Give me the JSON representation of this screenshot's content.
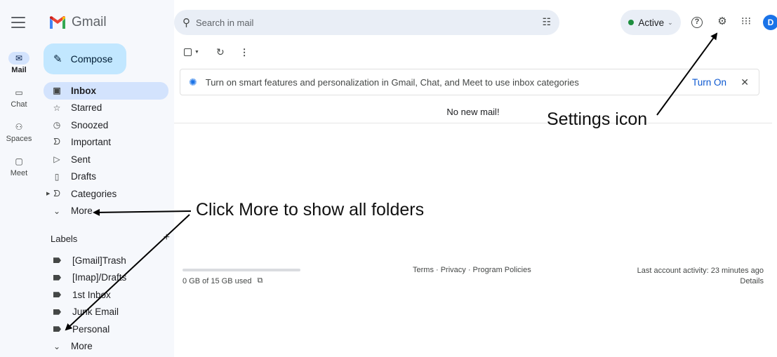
{
  "app": {
    "name": "Gmail"
  },
  "rail": {
    "items": [
      {
        "label": "Mail",
        "icon": "mail-icon",
        "active": true
      },
      {
        "label": "Chat",
        "icon": "chat-icon"
      },
      {
        "label": "Spaces",
        "icon": "spaces-icon"
      },
      {
        "label": "Meet",
        "icon": "meet-icon"
      }
    ]
  },
  "compose": {
    "label": "Compose"
  },
  "nav": {
    "items": [
      {
        "label": "Inbox",
        "icon": "inbox-icon",
        "active": true
      },
      {
        "label": "Starred",
        "icon": "star-icon"
      },
      {
        "label": "Snoozed",
        "icon": "clock-icon"
      },
      {
        "label": "Important",
        "icon": "important-icon"
      },
      {
        "label": "Sent",
        "icon": "send-icon"
      },
      {
        "label": "Drafts",
        "icon": "draft-icon"
      },
      {
        "label": "Categories",
        "icon": "category-icon"
      },
      {
        "label": "More",
        "icon": "chevron-down-icon"
      }
    ]
  },
  "labels": {
    "title": "Labels",
    "add": "+",
    "items": [
      {
        "label": "[Gmail]Trash"
      },
      {
        "label": "[Imap]/Drafts"
      },
      {
        "label": "1st Inbox"
      },
      {
        "label": "Junk Email"
      },
      {
        "label": "Personal"
      }
    ],
    "more": "More"
  },
  "search": {
    "placeholder": "Search in mail"
  },
  "status": {
    "label": "Active",
    "color": "#1e8e3e"
  },
  "avatar": {
    "initial": "D",
    "color": "#1a73e8"
  },
  "banner": {
    "text": "Turn on smart features and personalization in Gmail, Chat, and Meet to use inbox categories",
    "action": "Turn On",
    "close": "✕"
  },
  "main": {
    "empty": "No new mail!",
    "storage": "0 GB of 15 GB used",
    "footer_links": "Terms · Privacy · Program Policies",
    "last_activity": "Last account activity: 23 minutes ago",
    "details": "Details"
  },
  "annotations": {
    "settings": "Settings icon",
    "more": "Click More to show all folders"
  },
  "colors": {
    "accent": "#0b57d0",
    "selected": "#d3e3fd",
    "compose": "#c2e7ff",
    "surface": "#f6f8fc"
  }
}
